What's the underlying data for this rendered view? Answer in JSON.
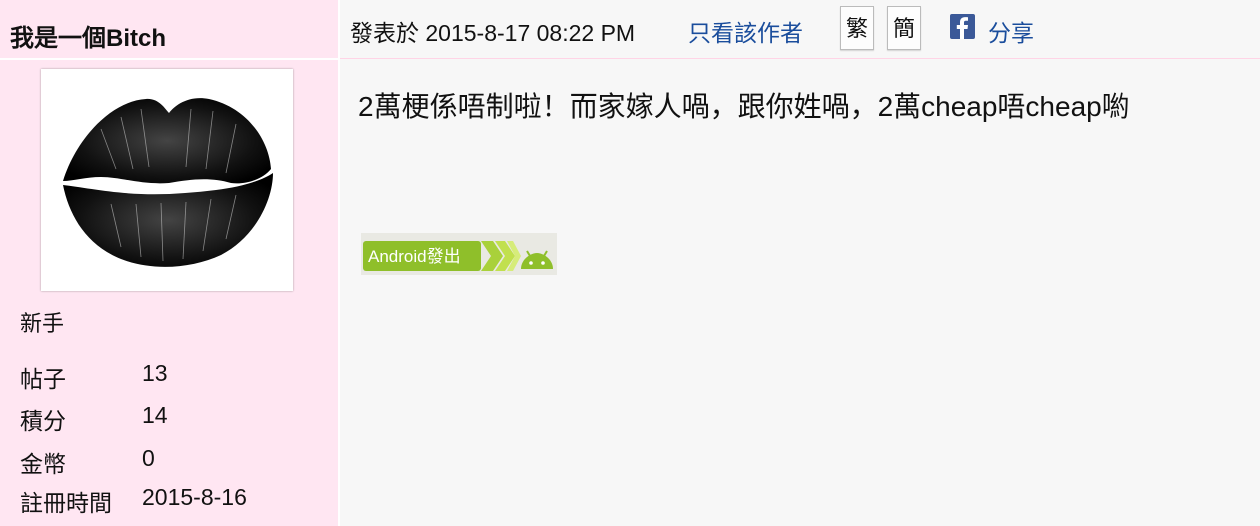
{
  "author": {
    "name": "我是一個Bitch",
    "rank": "新手",
    "stats": [
      {
        "label": "帖子",
        "value": "13"
      },
      {
        "label": "積分",
        "value": "14"
      },
      {
        "label": "金幣",
        "value": "0"
      },
      {
        "label": "註冊時間",
        "value": "2015-8-16"
      }
    ]
  },
  "post": {
    "meta": "發表於 2015-8-17 08:22 PM",
    "author_only_link": "只看該作者",
    "traditional_label": "繁",
    "simplified_label": "簡",
    "share_label": "分享",
    "content": "2萬梗係唔制啦！而家嫁人喎，跟你姓喎，2萬cheap唔cheap喲",
    "badge_text": "Android發出"
  },
  "colors": {
    "sidebar_bg": "#ffe6f2",
    "content_bg": "#f7f7f7",
    "link": "#1a4d9c",
    "facebook": "#3b5998",
    "android_green": "#8fbf2a"
  },
  "icons": {
    "share": "facebook-icon",
    "avatar": "lips-avatar"
  }
}
